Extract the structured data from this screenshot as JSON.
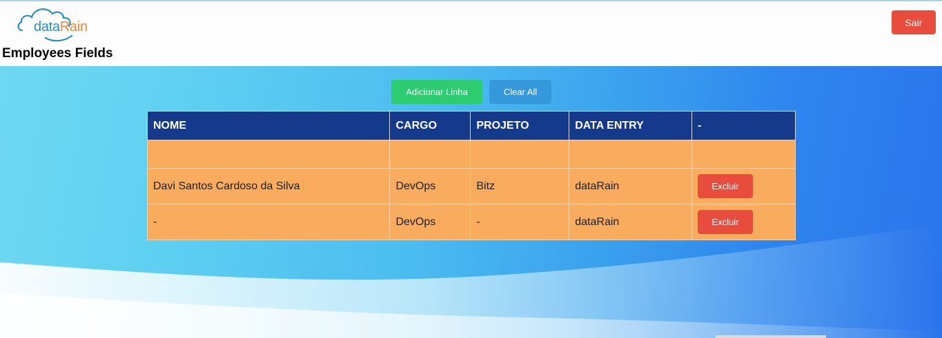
{
  "header": {
    "logo": {
      "part1": "data",
      "part2": "Rain"
    },
    "title": "Employees Fields",
    "logout_label": "Sair"
  },
  "toolbar": {
    "add_label": "Adicionar Linha",
    "clear_label": "Clear All"
  },
  "table": {
    "columns": [
      "NOME",
      "CARGO",
      "PROJETO",
      "DATA ENTRY",
      "-"
    ],
    "rows": [
      {
        "nome": "",
        "cargo": "",
        "projeto": "",
        "data_entry": "",
        "action": ""
      },
      {
        "nome": "Davi Santos Cardoso da Silva",
        "cargo": "DevOps",
        "projeto": "Bitz",
        "data_entry": "dataRain",
        "action": "Excluir"
      },
      {
        "nome": "-",
        "cargo": "DevOps",
        "projeto": "-",
        "data_entry": "dataRain",
        "action": "Excluir"
      }
    ]
  },
  "colors": {
    "header_row": "#163a8b",
    "body_row": "#f9ab5e",
    "add_button": "#2ecc71",
    "clear_button": "#3498db",
    "danger_button": "#e74c3c"
  }
}
